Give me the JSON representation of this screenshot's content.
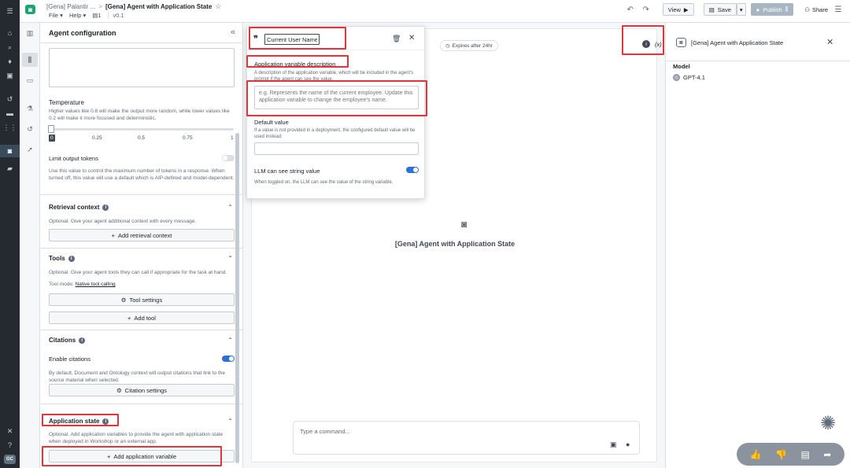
{
  "header": {
    "breadcrumb_parent": "[Gena] Palantir ...",
    "breadcrumb_separator": ">",
    "title": "[Gena] Agent with Application State",
    "menu_file": "File",
    "menu_help": "Help",
    "pages_count": "1",
    "version": "v0.1",
    "view_label": "View",
    "save_label": "Save",
    "publish_label": "Publish",
    "share_label": "Share"
  },
  "config": {
    "title": "Agent configuration",
    "temperature_label": "Temperature",
    "temperature_desc": "Higher values like 0.8 will make the output more random, while lower values like 0.2 will make it more focused and deterministic.",
    "temperature_value": 0,
    "ticks": [
      "0",
      "0.25",
      "0.5",
      "0.75",
      "1"
    ],
    "limit_tokens_label": "Limit output tokens",
    "limit_tokens_desc": "Use this value to control the maximum number of tokens in a response. When turned off, this value will use a default which is AIP-defined and model-dependent.",
    "retrieval_title": "Retrieval context",
    "retrieval_desc": "Optional. Give your agent additional context with every message.",
    "retrieval_button": "Add retrieval context",
    "tools_title": "Tools",
    "tools_desc": "Optional. Give your agent tools they can call if appropriate for the task at hand.",
    "tool_mode_label": "Tool mode:",
    "tool_mode_value": "Native tool calling",
    "tool_settings_button": "Tool settings",
    "add_tool_button": "Add tool",
    "citations_title": "Citations",
    "enable_citations_label": "Enable citations",
    "citations_desc": "By default, Document and Ontology context will output citations that link to the source material when selected.",
    "citation_settings_button": "Citation settings",
    "app_state_title": "Application state",
    "app_state_desc": "Optional. Add application variables to provide the agent with application state when deployed in Workshop or an external app.",
    "add_app_var_button": "Add application variable"
  },
  "popover": {
    "variable_name": "Current User Name",
    "desc_label": "Application variable description",
    "desc_help": "A description of the application variable, which will be included in the agent's prompt if the agent can see the value.",
    "desc_placeholder": "e.g. Represents the name of the current employee. Update this application variable to change the employee's name.",
    "default_label": "Default value",
    "default_help": "If a value is not provided in a deployment, the configured default value will be used instead.",
    "llm_label": "LLM can see string value",
    "llm_help": "When toggled on, the LLM can see the value of the string variable."
  },
  "center": {
    "expires_label": "Expires after 24hr",
    "variables_label": "(x)",
    "agent_name": "[Gena] Agent with Application State",
    "composer_placeholder": "Type a command..."
  },
  "right": {
    "title": "[Gena] Agent with Application State",
    "model_label": "Model",
    "model_value": "GPT-4.1"
  },
  "colors": {
    "highlight": "#e0353b",
    "toggle_on": "#2d72d2",
    "brand": "#1ea376"
  }
}
